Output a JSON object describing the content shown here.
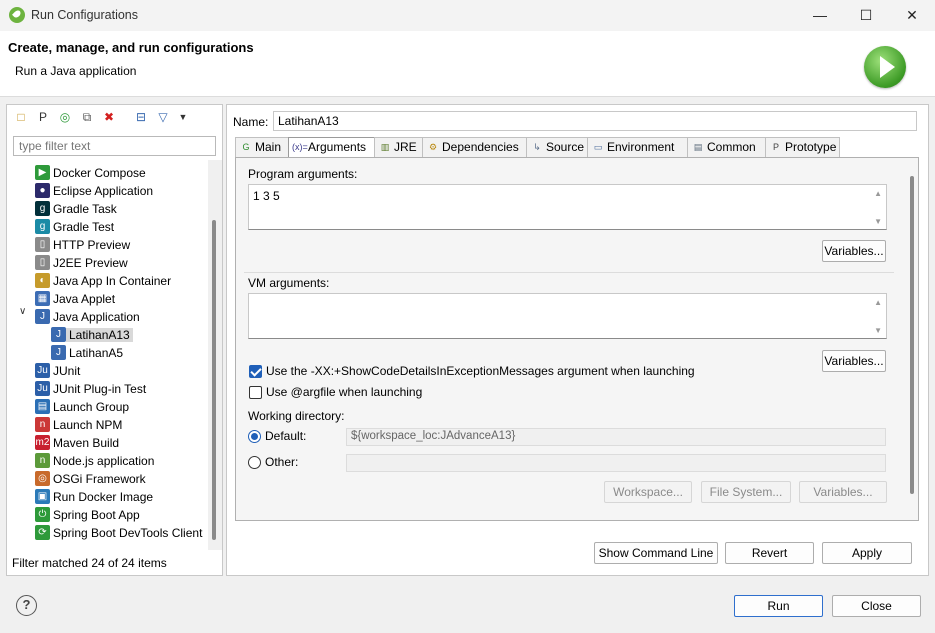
{
  "window": {
    "title": "Run Configurations",
    "minimize": "—",
    "maximize": "☐",
    "close": "✕"
  },
  "header": {
    "title": "Create, manage, and run configurations",
    "subtitle": "Run a Java application"
  },
  "left": {
    "filter_placeholder": "type filter text",
    "items": [
      {
        "label": "Docker Compose",
        "icon": "docker-compose-icon",
        "color": "#2e9a3a",
        "glyph": "▶"
      },
      {
        "label": "Eclipse Application",
        "icon": "eclipse-icon",
        "color": "#2c2a6b",
        "glyph": "●"
      },
      {
        "label": "Gradle Task",
        "icon": "gradle-icon",
        "color": "#02303a",
        "glyph": "g"
      },
      {
        "label": "Gradle Test",
        "icon": "gradle-test-icon",
        "color": "#1b8ba6",
        "glyph": "g"
      },
      {
        "label": "HTTP Preview",
        "icon": "http-preview-icon",
        "color": "#8a8a8a",
        "glyph": "▯"
      },
      {
        "label": "J2EE Preview",
        "icon": "j2ee-preview-icon",
        "color": "#8a8a8a",
        "glyph": "▯"
      },
      {
        "label": "Java App In Container",
        "icon": "java-container-icon",
        "color": "#c69b2b",
        "glyph": "◐"
      },
      {
        "label": "Java Applet",
        "icon": "java-applet-icon",
        "color": "#3c6db5",
        "glyph": "▦"
      },
      {
        "label": "Java Application",
        "icon": "java-application-icon",
        "color": "#3a6ab0",
        "glyph": "J"
      },
      {
        "label": "LatihanA13",
        "icon": "java-application-icon",
        "color": "#3a6ab0",
        "glyph": "J"
      },
      {
        "label": "LatihanA5",
        "icon": "java-application-icon",
        "color": "#3a6ab0",
        "glyph": "J"
      },
      {
        "label": "JUnit",
        "icon": "junit-icon",
        "color": "#2c5fa8",
        "glyph": "Ju"
      },
      {
        "label": "JUnit Plug-in Test",
        "icon": "junit-plugin-icon",
        "color": "#2c5fa8",
        "glyph": "Ju"
      },
      {
        "label": "Launch Group",
        "icon": "launch-group-icon",
        "color": "#2b6fb5",
        "glyph": "▤"
      },
      {
        "label": "Launch NPM",
        "icon": "npm-icon",
        "color": "#cb3837",
        "glyph": "n"
      },
      {
        "label": "Maven Build",
        "icon": "maven-icon",
        "color": "#c8202f",
        "glyph": "m2"
      },
      {
        "label": "Node.js application",
        "icon": "nodejs-icon",
        "color": "#5c9a3a",
        "glyph": "n"
      },
      {
        "label": "OSGi Framework",
        "icon": "osgi-icon",
        "color": "#c86a2b",
        "glyph": "◎"
      },
      {
        "label": "Run Docker Image",
        "icon": "docker-image-icon",
        "color": "#2b7ab8",
        "glyph": "▣"
      },
      {
        "label": "Spring Boot App",
        "icon": "spring-boot-icon",
        "color": "#2e9a3a",
        "glyph": "⏻"
      },
      {
        "label": "Spring Boot DevTools Client",
        "icon": "spring-devtools-icon",
        "color": "#2e9a3a",
        "glyph": "⟳"
      }
    ],
    "filter_status": "Filter matched 24 of 24 items"
  },
  "right": {
    "name_label": "Name:",
    "name_value": "LatihanA13",
    "tabs": [
      {
        "label": "Main",
        "icon": "main-tab-icon",
        "glyph": "G",
        "color": "#2e8b2e"
      },
      {
        "label": "Arguments",
        "icon": "arguments-tab-icon",
        "glyph": "(x)=",
        "color": "#3a3a8a"
      },
      {
        "label": "JRE",
        "icon": "jre-tab-icon",
        "glyph": "▥",
        "color": "#5a7a2a"
      },
      {
        "label": "Dependencies",
        "icon": "dependencies-tab-icon",
        "glyph": "⚙",
        "color": "#b8860b"
      },
      {
        "label": "Source",
        "icon": "source-tab-icon",
        "glyph": "↳",
        "color": "#5a6e8a"
      },
      {
        "label": "Environment",
        "icon": "environment-tab-icon",
        "glyph": "▭",
        "color": "#4a6a9a"
      },
      {
        "label": "Common",
        "icon": "common-tab-icon",
        "glyph": "▤",
        "color": "#5a6a7a"
      },
      {
        "label": "Prototype",
        "icon": "prototype-tab-icon",
        "glyph": "P",
        "color": "#444"
      }
    ],
    "program_args_label": "Program arguments:",
    "program_args_value": "1 3 5",
    "variables_label": "Variables...",
    "vm_args_label": "VM arguments:",
    "vm_args_value": "",
    "checkbox_showcode": "Use the -XX:+ShowCodeDetailsInExceptionMessages argument when launching",
    "checkbox_argfile": "Use @argfile when launching",
    "working_dir_label": "Working directory:",
    "default_label": "Default:",
    "default_value": "${workspace_loc:JAdvanceA13}",
    "other_label": "Other:",
    "workspace_btn": "Workspace...",
    "filesystem_btn": "File System...",
    "variables_btn_wd": "Variables...",
    "show_command_line": "Show Command Line",
    "revert": "Revert",
    "apply": "Apply"
  },
  "footer": {
    "run": "Run",
    "close": "Close",
    "help": "?"
  }
}
